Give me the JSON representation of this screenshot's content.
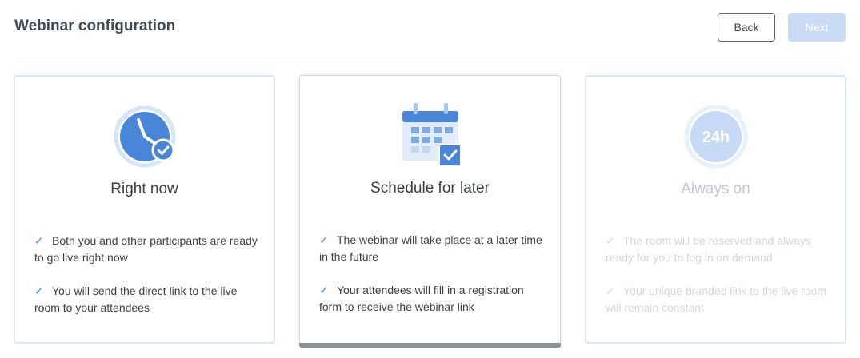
{
  "header": {
    "title": "Webinar configuration",
    "back_label": "Back",
    "next_label": "Next"
  },
  "cards": [
    {
      "title": "Right now",
      "icon": "clock-check-icon",
      "state": "default",
      "features": [
        "Both you and other participants are ready to go live right now",
        "You will send the direct link to the live room to your attendees"
      ]
    },
    {
      "title": "Schedule for later",
      "icon": "calendar-check-icon",
      "state": "selected",
      "features": [
        "The webinar will take place at a later time in the future",
        "Your attendees will fill in a registration form to receive the webinar link"
      ]
    },
    {
      "title": "Always on",
      "icon": "24h-icon",
      "icon_text": "24h",
      "state": "disabled",
      "features": [
        "The room will be reserved and always ready for you to log in on demand",
        "Your unique branded link to the live room will remain constant"
      ]
    }
  ],
  "colors": {
    "accent": "#4a86d8",
    "next_disabled": "#c9dcf4",
    "card_border": "#dbe8f6"
  }
}
